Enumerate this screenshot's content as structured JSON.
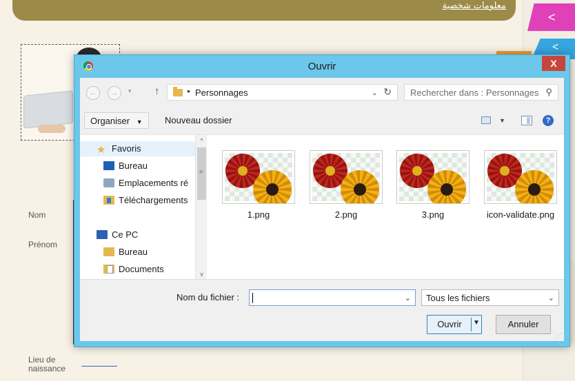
{
  "background_page": {
    "banner_link": "معلومات شخصية",
    "tab_pink_arrow": "<",
    "tab_blue_arrow": "<",
    "labels": {
      "nom": "Nom",
      "prenom": "Prénom",
      "lieu_line1": "Lieu de",
      "lieu_line2": "naissance"
    }
  },
  "dialog": {
    "title": "Ouvrir",
    "close_label": "X",
    "nav": {
      "back_icon": "back-arrow-icon",
      "forward_icon": "forward-arrow-icon",
      "up_icon": "up-arrow-icon",
      "path_separator": "▸",
      "path": "Personnages",
      "dropdown_glyph": "⌄",
      "refresh_glyph": "↻",
      "search_placeholder": "Rechercher dans : Personnages",
      "search_glyph": "⚲"
    },
    "toolbar": {
      "organize": "Organiser",
      "organize_caret": "▼",
      "new_folder": "Nouveau dossier",
      "view_caret": "▼",
      "help_glyph": "?"
    },
    "sidebar": {
      "items": [
        {
          "label": "Favoris",
          "icon": "star-icon"
        },
        {
          "label": "Bureau",
          "icon": "desktop-icon"
        },
        {
          "label": "Emplacements ré",
          "icon": "network-places-icon"
        },
        {
          "label": "Téléchargements",
          "icon": "downloads-folder-icon"
        },
        {
          "label": "Ce PC",
          "icon": "computer-icon"
        },
        {
          "label": "Bureau",
          "icon": "folder-icon"
        },
        {
          "label": "Documents",
          "icon": "documents-folder-icon"
        }
      ],
      "scroll_up": "^",
      "scroll_down": "v",
      "scroll_grip": "≡"
    },
    "files": [
      {
        "name": "1.png",
        "icon": "image-thumbnail-icon"
      },
      {
        "name": "2.png",
        "icon": "image-thumbnail-icon"
      },
      {
        "name": "3.png",
        "icon": "image-thumbnail-icon"
      },
      {
        "name": "icon-validate.png",
        "icon": "image-thumbnail-icon"
      }
    ],
    "bottom": {
      "filename_label": "Nom du fichier :",
      "filename_value": "",
      "filetype": "Tous les fichiers",
      "dropdown_glyph": "⌄",
      "open_button": "Ouvrir",
      "open_caret": "▼",
      "cancel_button": "Annuler",
      "resize_grip": "⋰"
    }
  },
  "colors": {
    "dialog_frame": "#6cc7ea",
    "close_button": "#c7463b",
    "banner": "#9c8a48",
    "tab_pink": "#e040b8",
    "tab_blue": "#35a6e0",
    "selection": "#e5f1fb"
  }
}
